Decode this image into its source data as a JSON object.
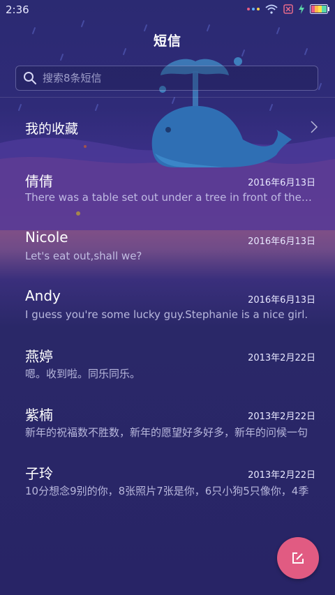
{
  "status_bar": {
    "time": "2:36"
  },
  "header": {
    "title": "短信"
  },
  "search": {
    "placeholder": "搜索8条短信"
  },
  "favorites": {
    "label": "我的收藏"
  },
  "conversations": [
    {
      "name": "倩倩",
      "date": "2016年6月13日",
      "preview": "There was a table set out under a tree in front of the house, and the March Hare"
    },
    {
      "name": "Nicole",
      "date": "2016年6月13日",
      "preview": "Let's eat out,shall we?"
    },
    {
      "name": "Andy",
      "date": "2016年6月13日",
      "preview": "I guess you're some lucky guy.Stephanie is a nice girl."
    },
    {
      "name": "燕婷",
      "date": "2013年2月22日",
      "preview": "嗯。收到啦。同乐同乐。"
    },
    {
      "name": "紫楠",
      "date": "2013年2月22日",
      "preview": "新年的祝福数不胜数，新年的愿望好多好多，新年的问候一句"
    },
    {
      "name": "子玲",
      "date": "2013年2月22日",
      "preview": "10分想念9别的你，8张照片7张是你，6只小狗5只像你，4季"
    }
  ],
  "compose": {
    "icon": "edit-icon"
  },
  "colors": {
    "accent": "#e15b82",
    "background": "#2b2a72"
  }
}
